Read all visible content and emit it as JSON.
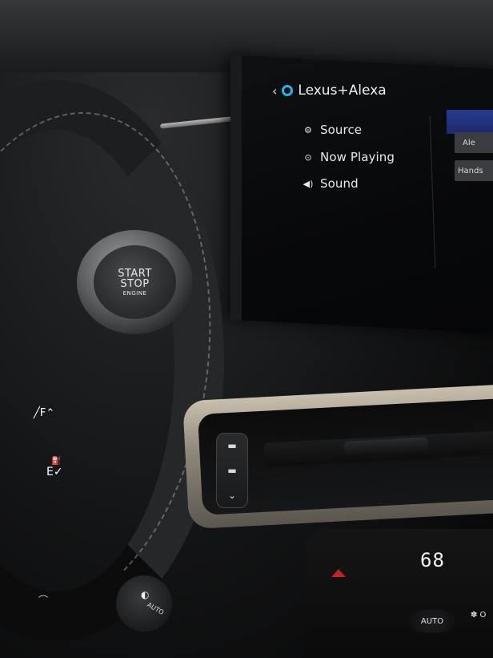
{
  "screen": {
    "title": "Lexus+Alexa",
    "back_icon": "chevron-left-icon",
    "alexa_icon": "alexa-ring-icon",
    "alexa_color": "#21b6e6",
    "menu": [
      {
        "label": "Source",
        "icon": "source-icon"
      },
      {
        "label": "Now Playing",
        "icon": "play-icon"
      },
      {
        "label": "Sound",
        "icon": "speaker-icon"
      }
    ],
    "right_buttons": [
      "Ale",
      "Hands"
    ]
  },
  "start_button": {
    "line1": "START",
    "line2": "STOP",
    "line3": "ENGINE"
  },
  "fuel_gauge": {
    "full": "F",
    "empty": "E"
  },
  "climate": {
    "temperature": "68",
    "auto_label": "AUTO",
    "fan_label": "✽ O"
  },
  "knob": {
    "label": "AUTO"
  },
  "colors": {
    "warning_red": "#c2202a",
    "screen_accent_blue": "#1c2a6a"
  }
}
